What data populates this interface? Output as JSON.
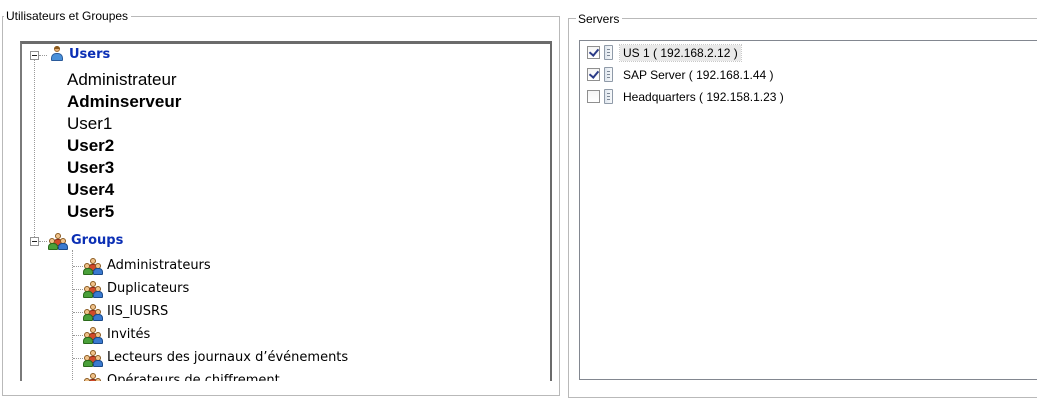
{
  "left_group": {
    "title": "Utilisateurs et Groupes",
    "users_root": "Users",
    "users": [
      {
        "name": "Administrateur",
        "bold": false
      },
      {
        "name": "Adminserveur",
        "bold": true
      },
      {
        "name": "User1",
        "bold": false
      },
      {
        "name": "User2",
        "bold": true
      },
      {
        "name": "User3",
        "bold": true
      },
      {
        "name": "User4",
        "bold": true
      },
      {
        "name": "User5",
        "bold": true
      }
    ],
    "groups_root": "Groups",
    "groups": [
      "Administrateurs",
      "Duplicateurs",
      "IIS_IUSRS",
      "Invités",
      "Lecteurs des journaux d’événements",
      "Opérateurs de chiffrement"
    ]
  },
  "right_group": {
    "title": "Servers",
    "servers": [
      {
        "label": "US 1 ( 192.168.2.12 )",
        "checked": true,
        "selected": true
      },
      {
        "label": "SAP Server ( 192.168.1.44 )",
        "checked": true,
        "selected": false
      },
      {
        "label": "Headquarters ( 192.158.1.23 )",
        "checked": false,
        "selected": false
      }
    ]
  },
  "icons": {
    "user_root": "user-icon",
    "group_root": "group-icon",
    "group_item": "group-icon",
    "server_item": "server-icon",
    "expand": "minus-expander-icon"
  }
}
